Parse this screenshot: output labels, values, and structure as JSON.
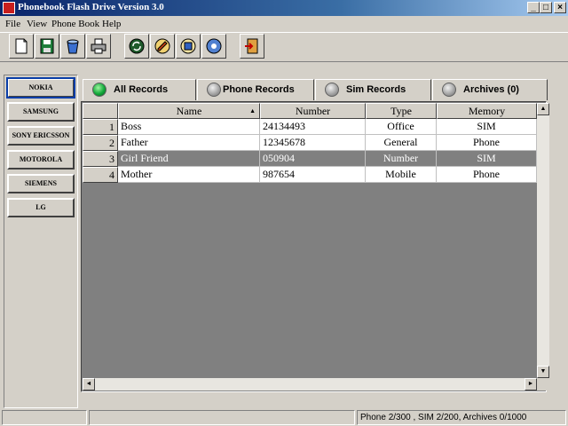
{
  "window": {
    "title": "Phonebook Flash Drive Version 3.0",
    "min": "_",
    "max": "□",
    "close": "×"
  },
  "menu": [
    "File",
    "View",
    "Phone Book",
    "Help"
  ],
  "toolbar_icons": [
    "new-icon",
    "save-icon",
    "delete-icon",
    "print-icon",
    "sync-icon",
    "edit-icon",
    "save-disk-icon",
    "dial-icon",
    "exit-icon"
  ],
  "brands": [
    "NOKIA",
    "SAMSUNG",
    "SONY ERICSSON",
    "MOTOROLA",
    "SIEMENS",
    "LG"
  ],
  "tabs": [
    {
      "label": "All Records",
      "active": true
    },
    {
      "label": "Phone Records",
      "active": false
    },
    {
      "label": "Sim Records",
      "active": false
    },
    {
      "label": "Archives (0)",
      "active": false
    }
  ],
  "table": {
    "columns": [
      "Name",
      "Number",
      "Type",
      "Memory"
    ],
    "rows": [
      {
        "n": "1",
        "name": "Boss",
        "number": "24134493",
        "type": "Office",
        "memory": "SIM"
      },
      {
        "n": "2",
        "name": "Father",
        "number": "12345678",
        "type": "General",
        "memory": "Phone"
      },
      {
        "n": "3",
        "name": "Girl Friend",
        "number": "050904",
        "type": "Number",
        "memory": "SIM"
      },
      {
        "n": "4",
        "name": "Mother",
        "number": "987654",
        "type": "Mobile",
        "memory": "Phone"
      }
    ],
    "selected_row": 3
  },
  "scroll": {
    "up": "▲",
    "down": "▼",
    "left": "◄",
    "right": "►",
    "sort": "▲"
  },
  "status": {
    "panel1": "",
    "panel2": "",
    "panel3": "Phone 2/300 , SIM 2/200, Archives 0/1000"
  },
  "colors": {
    "title_start": "#0a246a",
    "selection": "#808080",
    "active_tab_led": "#12a83a"
  }
}
